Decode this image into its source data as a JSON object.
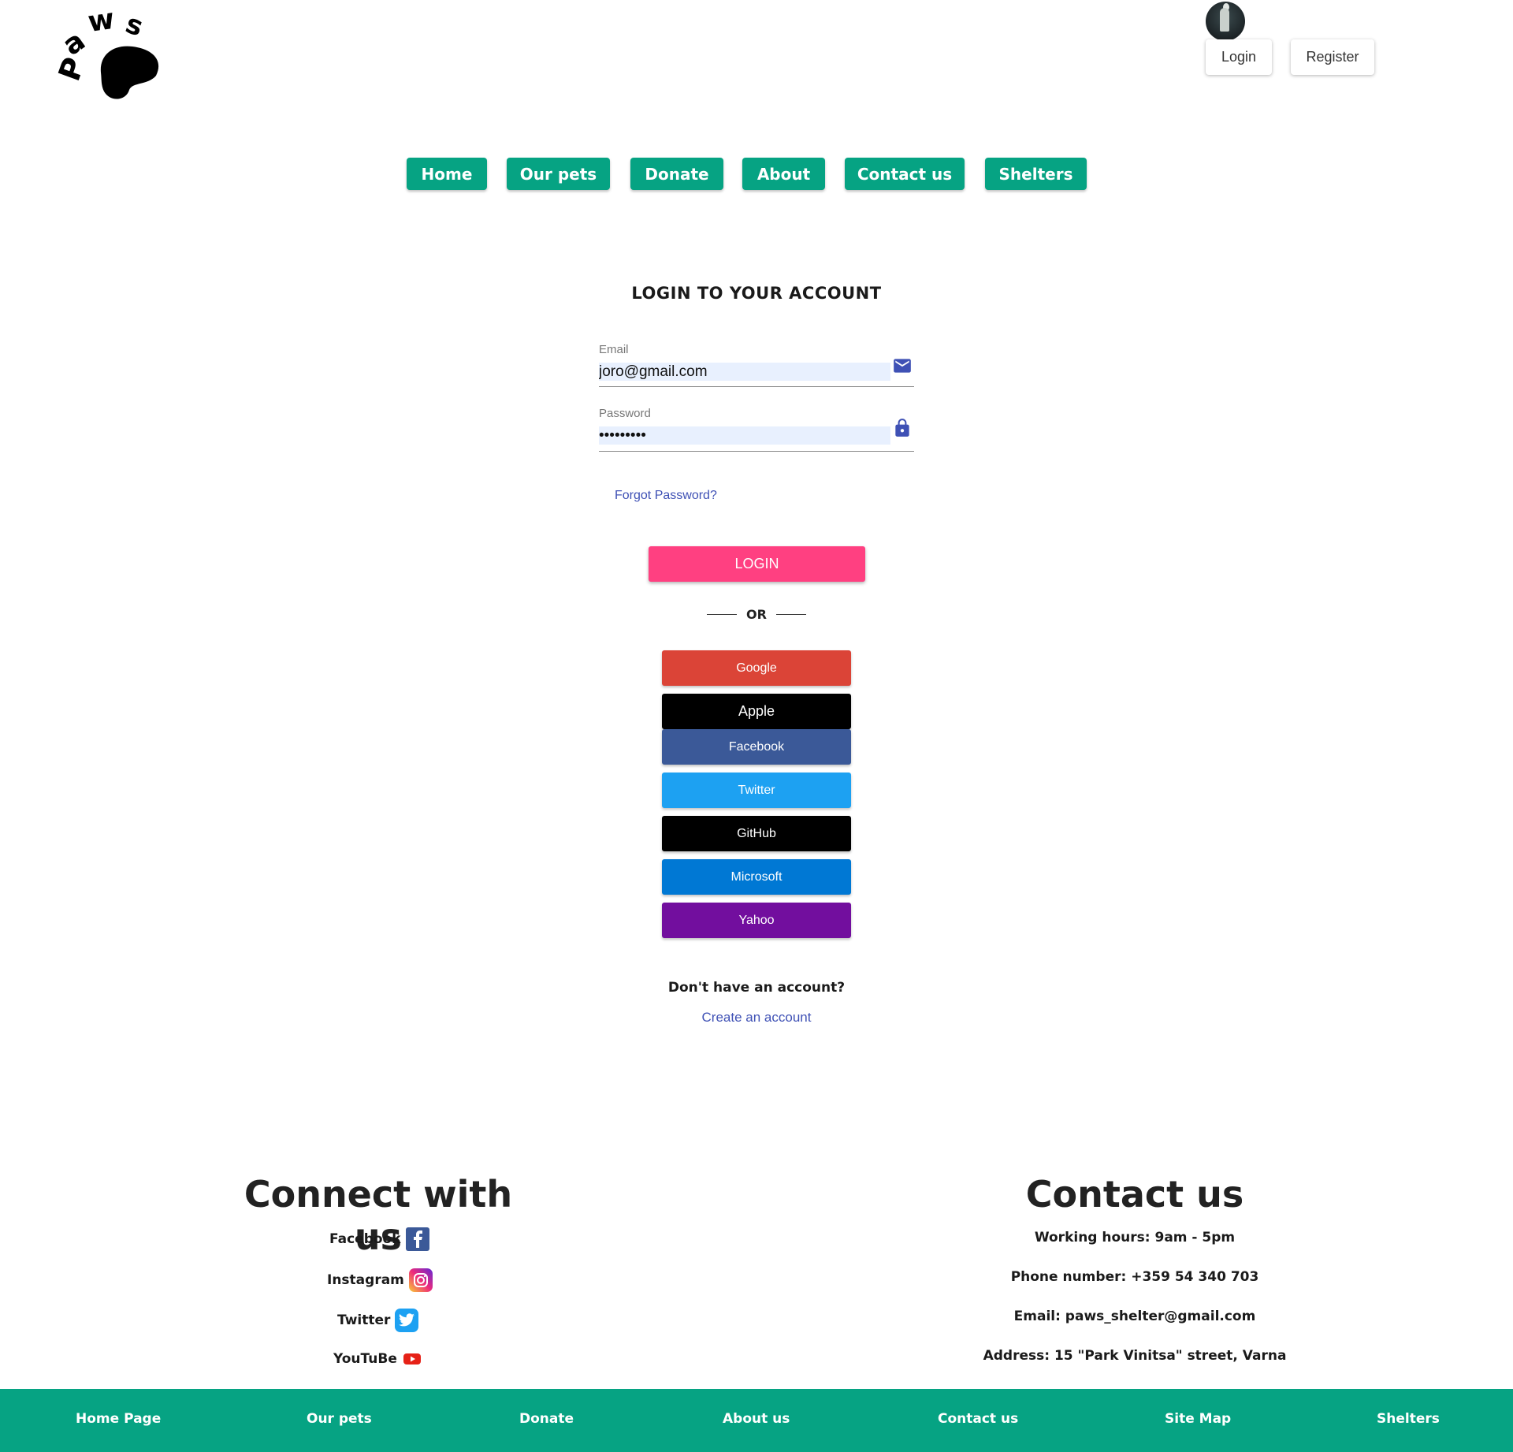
{
  "header": {
    "login_label": "Login",
    "register_label": "Register"
  },
  "nav": {
    "items": [
      {
        "label": "Home"
      },
      {
        "label": "Our pets"
      },
      {
        "label": "Donate"
      },
      {
        "label": "About"
      },
      {
        "label": "Contact us"
      },
      {
        "label": "Shelters"
      }
    ]
  },
  "login_form": {
    "title": "LOGIN TO YOUR ACCOUNT",
    "email_label": "Email",
    "email_value": "joro@gmail.com",
    "password_label": "Password",
    "password_value": "123456789",
    "forgot_label": "Forgot Password?",
    "submit_label": "LOGIN",
    "or_label": "OR",
    "no_account_text": "Don't have an account?",
    "create_account_label": "Create an account"
  },
  "social_logins": [
    {
      "label": "Google",
      "color": "#db4437"
    },
    {
      "label": "Apple",
      "color": "#000000"
    },
    {
      "label": "Facebook",
      "color": "#3b5998"
    },
    {
      "label": "Twitter",
      "color": "#1da1f2"
    },
    {
      "label": "GitHub",
      "color": "#000000"
    },
    {
      "label": "Microsoft",
      "color": "#0078d4"
    },
    {
      "label": "Yahoo",
      "color": "#720e9e"
    }
  ],
  "connect": {
    "title": "Connect with us",
    "links": [
      {
        "label": "Facebook",
        "icon": "facebook-icon"
      },
      {
        "label": "Instagram",
        "icon": "instagram-icon"
      },
      {
        "label": "Twitter",
        "icon": "twitter-icon"
      },
      {
        "label": "YouTuBe",
        "icon": "youtube-icon"
      }
    ]
  },
  "contact": {
    "title": "Contact us",
    "working_hours": "Working hours: 9am - 5pm",
    "phone": "Phone number: +359 54 340 703",
    "email": "Email: paws_shelter@gmail.com",
    "address": "Address: 15 \"Park Vinitsa\" street, Varna"
  },
  "footer_nav": [
    {
      "label": "Home Page"
    },
    {
      "label": "Our pets"
    },
    {
      "label": "Donate"
    },
    {
      "label": "About us"
    },
    {
      "label": "Contact us"
    },
    {
      "label": "Site Map"
    },
    {
      "label": "Shelters"
    }
  ],
  "colors": {
    "primary": "#06a383",
    "login_button": "#ff4081",
    "link": "#3f51b5",
    "input_fill": "#e8f0fe"
  }
}
